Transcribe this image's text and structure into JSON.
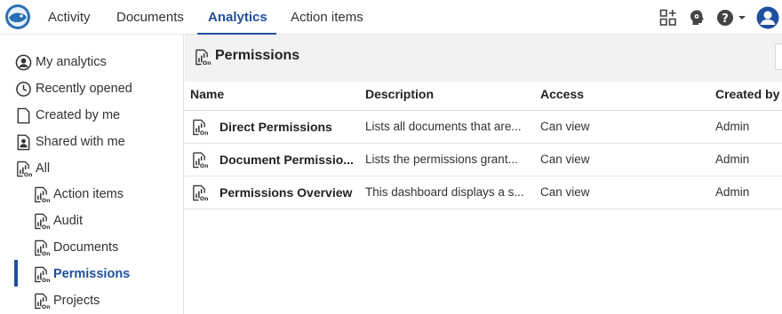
{
  "topnav": {
    "tabs": [
      {
        "label": "Activity"
      },
      {
        "label": "Documents"
      },
      {
        "label": "Analytics"
      },
      {
        "label": "Action items"
      }
    ],
    "active_tab": "Analytics",
    "accent_color": "#1f4fa0"
  },
  "top_icons": [
    "app-grid-icon",
    "brain-gear-icon",
    "help-icon",
    "user-avatar-icon"
  ],
  "sidebar": {
    "items": [
      {
        "label": "My analytics",
        "icon": "user-circle-icon"
      },
      {
        "label": "Recently opened",
        "icon": "clock-icon"
      },
      {
        "label": "Created by me",
        "icon": "document-icon"
      },
      {
        "label": "Shared with me",
        "icon": "shared-user-icon"
      },
      {
        "label": "All",
        "icon": "analytics-report-icon"
      },
      {
        "label": "Action items",
        "icon": "analytics-report-icon"
      },
      {
        "label": "Audit",
        "icon": "analytics-report-icon"
      },
      {
        "label": "Documents",
        "icon": "analytics-report-icon"
      },
      {
        "label": "Permissions",
        "icon": "analytics-report-icon"
      },
      {
        "label": "Projects",
        "icon": "analytics-report-icon"
      }
    ],
    "active_item": "Permissions"
  },
  "main": {
    "title": "Permissions",
    "columns": {
      "name": "Name",
      "description": "Description",
      "access": "Access",
      "created_by": "Created by"
    },
    "rows": [
      {
        "name": "Direct Permissions",
        "description": "Lists all documents that are...",
        "access": "Can view",
        "created_by": "Admin"
      },
      {
        "name": "Document Permissio...",
        "description": "Lists the permissions grant...",
        "access": "Can view",
        "created_by": "Admin"
      },
      {
        "name": "Permissions Overview",
        "description": "This dashboard displays a s...",
        "access": "Can view",
        "created_by": "Admin"
      }
    ]
  }
}
